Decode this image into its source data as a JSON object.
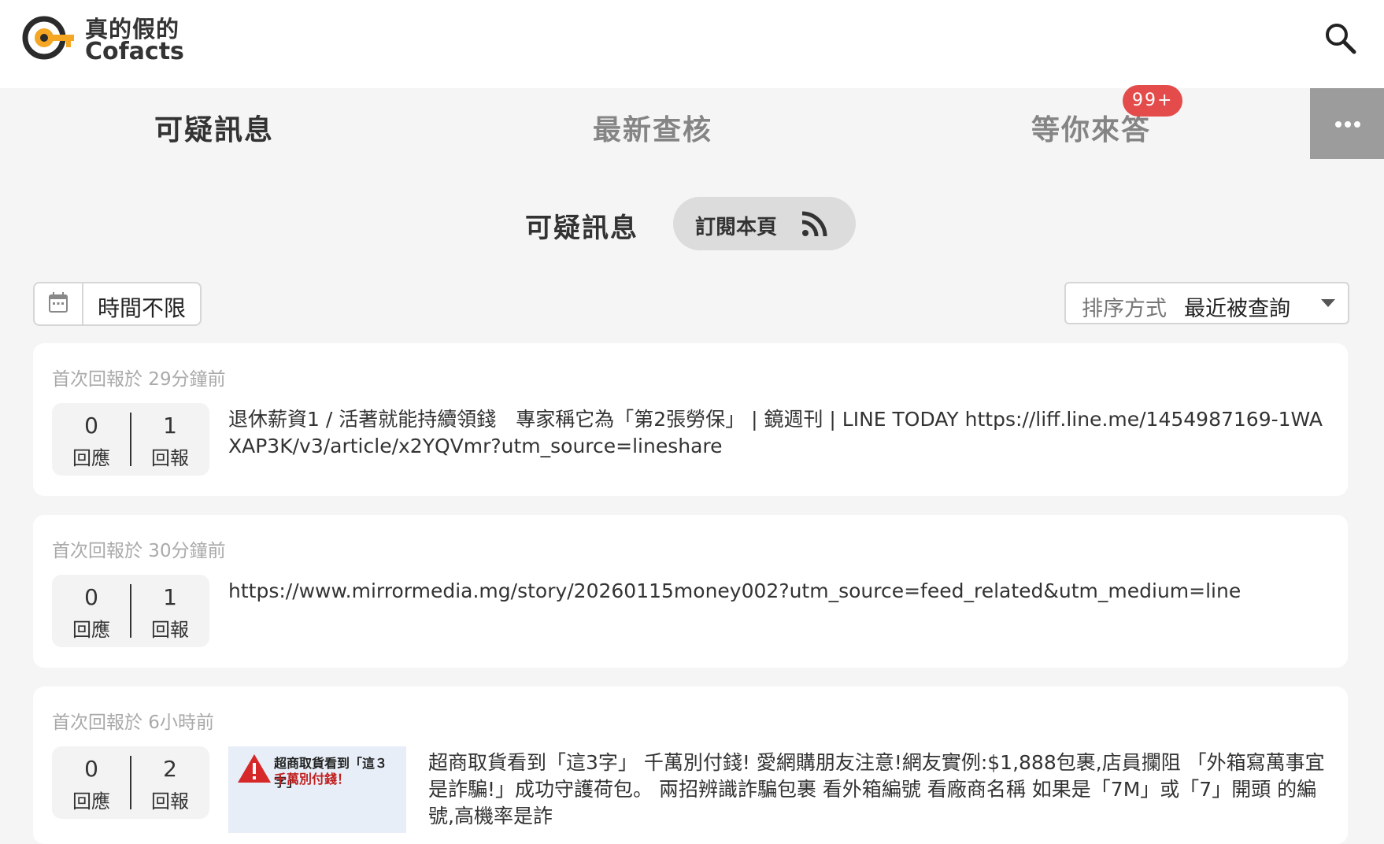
{
  "header": {
    "logo_cn": "真的假的",
    "logo_en": "Cofacts"
  },
  "tabs": [
    {
      "label": "可疑訊息",
      "active": true
    },
    {
      "label": "最新查核",
      "active": false
    },
    {
      "label": "等你來答",
      "active": false,
      "badge": "99+"
    }
  ],
  "page": {
    "title": "可疑訊息",
    "subscribe_label": "訂閱本頁"
  },
  "filters": {
    "date_label": "時間不限",
    "sort_label": "排序方式",
    "sort_value": "最近被查詢"
  },
  "articles": [
    {
      "meta": "首次回報於 29分鐘前",
      "replies": "0",
      "replies_label": "回應",
      "reports": "1",
      "reports_label": "回報",
      "text": "退休薪資1 / 活著就能持續領錢　專家稱它為「第2張勞保」 | 鏡週刊 | LINE TODAY https://liff.line.me/1454987169-1WAXAP3K/v3/article/x2YQVmr?utm_source=lineshare"
    },
    {
      "meta": "首次回報於 30分鐘前",
      "replies": "0",
      "replies_label": "回應",
      "reports": "1",
      "reports_label": "回報",
      "text": "https://www.mirrormedia.mg/story/20260115money002?utm_source=feed_related&utm_medium=line"
    },
    {
      "meta": "首次回報於 6小時前",
      "replies": "0",
      "replies_label": "回應",
      "reports": "2",
      "reports_label": "回報",
      "thumb_title_1": "超商取貨看到「這３字」",
      "thumb_title_2": "千萬別付錢！",
      "text": "超商取貨看到「這3字」 千萬別付錢! 愛網購朋友注意!網友實例:$1,888包裹,店員攔阻 「外箱寫萬事宜是詐騙!」成功守護荷包。 兩招辨識詐騙包裹 看外箱編號 看廠商名稱 如果是「7M」或「7」開頭 的編號,高機率是詐"
    }
  ],
  "colors": {
    "brand_orange": "#f5a623",
    "badge_red": "#e44b4b",
    "background": "#f5f5f5"
  }
}
